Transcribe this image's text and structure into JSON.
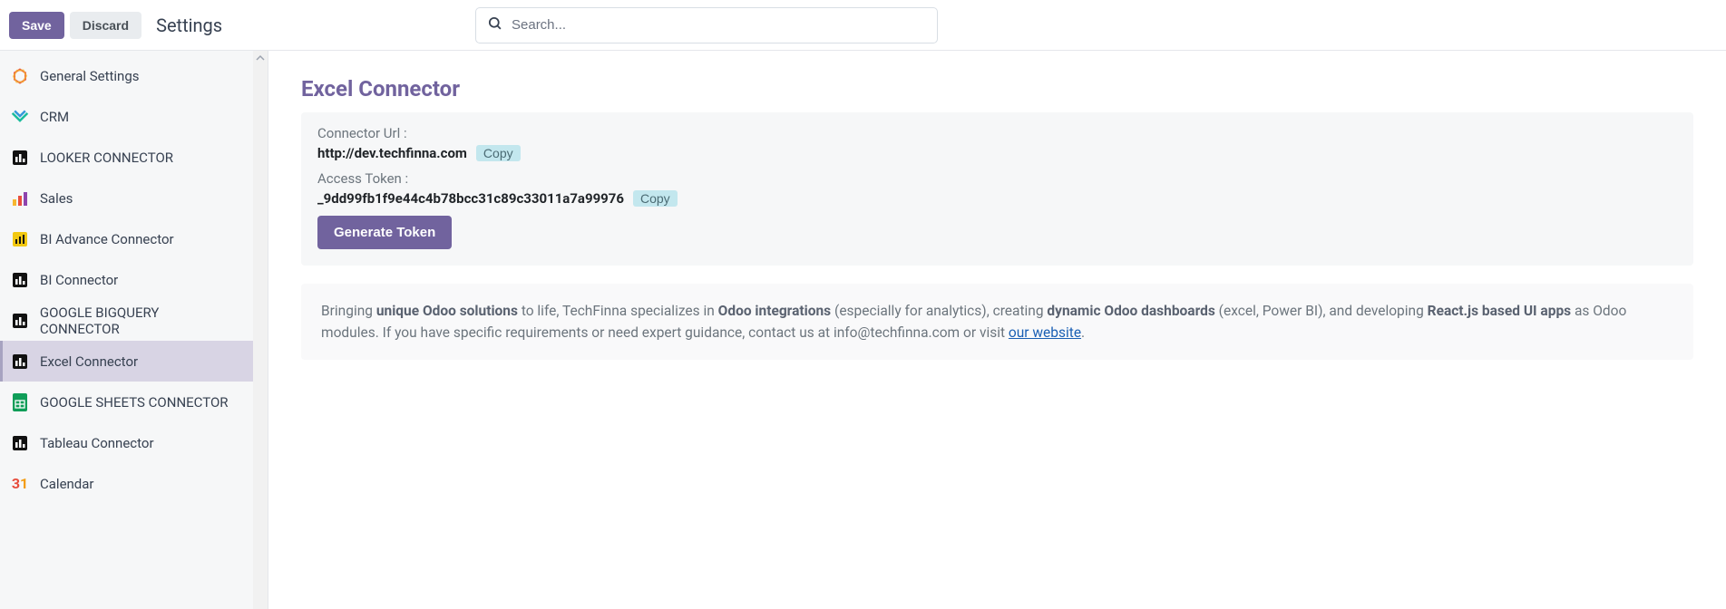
{
  "header": {
    "save_label": "Save",
    "discard_label": "Discard",
    "page_title": "Settings",
    "search_placeholder": "Search..."
  },
  "sidebar": {
    "items": [
      {
        "label": "General Settings",
        "icon": "general-icon",
        "active": false
      },
      {
        "label": "CRM",
        "icon": "crm-icon",
        "active": false
      },
      {
        "label": "LOOKER CONNECTOR",
        "icon": "looker-icon",
        "active": false
      },
      {
        "label": "Sales",
        "icon": "sales-icon",
        "active": false
      },
      {
        "label": "BI Advance Connector",
        "icon": "bi-adv-icon",
        "active": false
      },
      {
        "label": "BI Connector",
        "icon": "bi-icon",
        "active": false
      },
      {
        "label": "GOOGLE BIGQUERY CONNECTOR",
        "icon": "bigquery-icon",
        "active": false
      },
      {
        "label": "Excel Connector",
        "icon": "excel-icon",
        "active": true
      },
      {
        "label": "GOOGLE SHEETS CONNECTOR",
        "icon": "sheets-icon",
        "active": false
      },
      {
        "label": "Tableau Connector",
        "icon": "tableau-icon",
        "active": false
      },
      {
        "label": "Calendar",
        "icon": "calendar-icon",
        "active": false
      }
    ]
  },
  "section": {
    "title": "Excel Connector",
    "url_label": "Connector Url :",
    "url_value": "http://dev.techfinna.com",
    "url_copy": "Copy",
    "token_label": "Access Token :",
    "token_value": "_9dd99fb1f9e44c4b78bcc31c89c33011a7a99976",
    "token_copy": "Copy",
    "generate_label": "Generate Token"
  },
  "info": {
    "t1": "Bringing ",
    "b1": "unique Odoo solutions",
    "t2": " to life, TechFinna specializes in ",
    "b2": "Odoo integrations",
    "t3": " (especially for analytics), creating ",
    "b3": "dynamic Odoo dashboards",
    "t4": " (excel, Power BI), and developing ",
    "b4": "React.js based UI apps",
    "t5": " as Odoo modules. If you have specific requirements or need expert guidance, contact us at ",
    "email": "info@techfinna.com",
    "t6": " or visit ",
    "link": "our website",
    "t7": "."
  }
}
